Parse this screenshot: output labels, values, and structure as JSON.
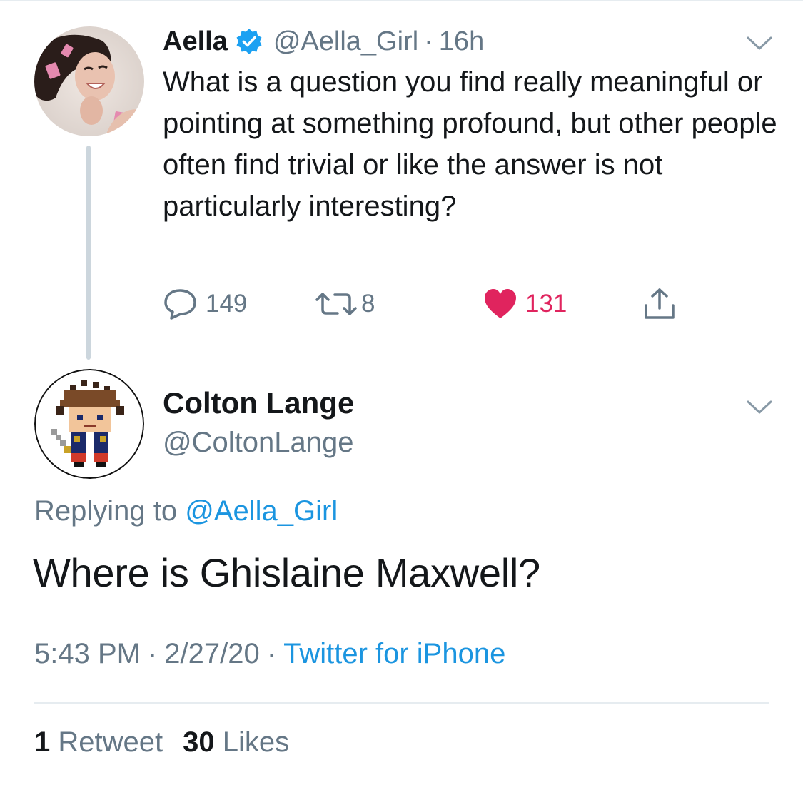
{
  "parent_tweet": {
    "author_name": "Aella",
    "handle": "@Aella_Girl",
    "separator": "·",
    "time": "16h",
    "text": "What is a question you find really meaningful or pointing at something profound, but other people often find trivial or like the answer is not particularly interesting?",
    "actions": {
      "replies": "149",
      "retweets": "8",
      "likes": "131"
    },
    "verified": true
  },
  "reply_tweet": {
    "author_name": "Colton Lange",
    "handle": "@ColtonLange",
    "replying_prefix": "Replying to",
    "replying_mention": "@Aella_Girl",
    "text": "Where is Ghislaine Maxwell?",
    "time": "5:43 PM",
    "date": "2/27/20",
    "separator": "·",
    "source": "Twitter for iPhone",
    "stats": {
      "retweets_count": "1",
      "retweets_label": "Retweet",
      "likes_count": "30",
      "likes_label": "Likes"
    }
  },
  "icons": {
    "verified": "verified-badge-icon",
    "chevron": "chevron-down-icon",
    "reply": "reply-icon",
    "retweet": "retweet-icon",
    "like": "heart-icon",
    "share": "share-icon"
  },
  "colors": {
    "text": "#14171a",
    "secondary": "#657786",
    "link": "#1b95e0",
    "like": "#e0245e",
    "verified": "#1da1f2",
    "thread_line": "#ccd6dd"
  }
}
